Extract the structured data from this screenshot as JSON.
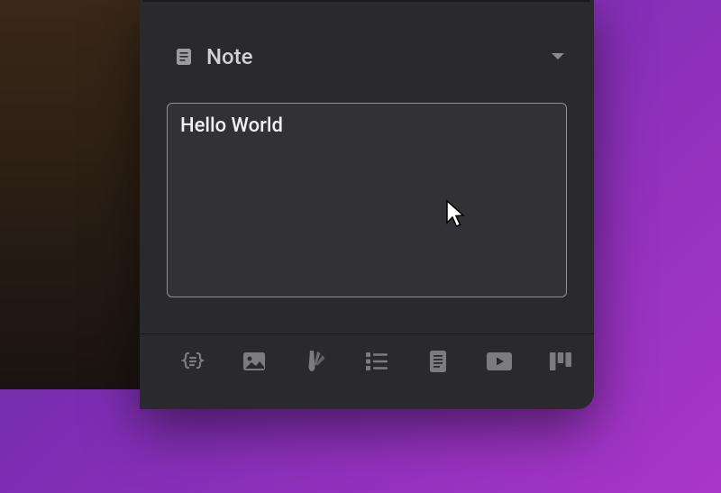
{
  "section": {
    "label": "Note"
  },
  "note": {
    "value": "Hello World"
  },
  "toolbar": {
    "items": [
      "json-icon",
      "image-icon",
      "color-picker-icon",
      "list-icon",
      "document-icon",
      "video-icon",
      "kanban-icon"
    ]
  }
}
